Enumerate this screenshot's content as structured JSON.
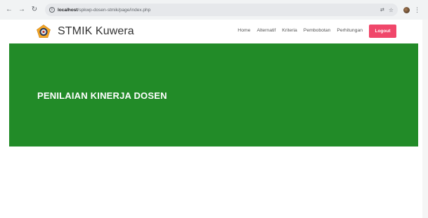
{
  "browser": {
    "url_host": "localhost",
    "url_path": "/spkwp-dosen-stmik/page/index.php",
    "icons": {
      "back": "arrow-left-icon",
      "forward": "arrow-right-icon",
      "reload": "reload-icon",
      "info": "info-icon",
      "translate": "translate-icon",
      "star": "star-icon",
      "menu": "kebab-menu-icon"
    }
  },
  "navbar": {
    "brand_name": "STMIK Kuwera",
    "links": [
      "Home",
      "Alternatif",
      "Kriteria",
      "Pembobotan",
      "Perhitungan"
    ],
    "logout_label": "Logout",
    "logout_color": "#f0476a"
  },
  "hero": {
    "title": "PENILAIAN KINERJA DOSEN",
    "background": "#228b28"
  }
}
